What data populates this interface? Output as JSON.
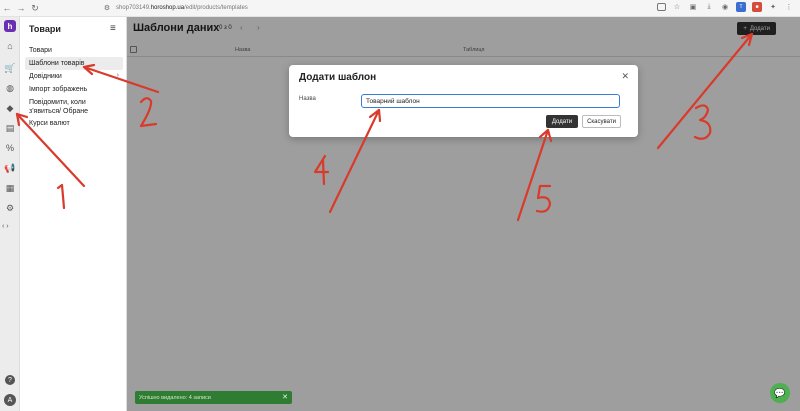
{
  "browser": {
    "url_prefix": "shop703149.",
    "url_domain": "horoshop.ua",
    "url_path": "/edit/products/templates"
  },
  "sidebar": {
    "title": "Товари",
    "items": [
      {
        "label": "Товари"
      },
      {
        "label": "Шаблони товарів",
        "active": true
      },
      {
        "label": "Довідники",
        "has_submenu": true
      },
      {
        "label": "Імпорт зображень"
      },
      {
        "label": "Повідомити, коли з'явиться/ Обране"
      },
      {
        "label": "Курси валют"
      }
    ]
  },
  "main": {
    "title": "Шаблони даних",
    "counter": "0 з 0",
    "add_button": "Додати",
    "columns": [
      "Назва",
      "Таблиця"
    ]
  },
  "modal": {
    "title": "Додати шаблон",
    "field_label": "Назва",
    "field_value": "Товарний шаблон",
    "submit": "Додати",
    "cancel": "Скасувати"
  },
  "toast": {
    "text": "Успішно видалено: 4 записи"
  },
  "annotations": {
    "color": "#d93a2b",
    "labels": [
      "1",
      "2",
      "3",
      "4",
      "5"
    ]
  },
  "colors": {
    "brand": "#6b2fb3",
    "primary_button": "#333333",
    "input_focus": "#3b7bd8",
    "toast": "#2e7d32",
    "chat": "#4caf50"
  }
}
